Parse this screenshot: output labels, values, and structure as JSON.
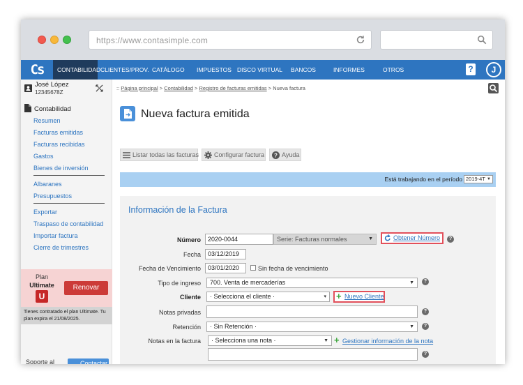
{
  "browser": {
    "url": "https://www.contasimple.com"
  },
  "nav": {
    "logo": "Cs",
    "items": [
      {
        "label": "CONTABILIDAD"
      },
      {
        "label": "CLIENTES/PROV."
      },
      {
        "label": "CATÁLOGO"
      },
      {
        "label": "IMPUESTOS"
      },
      {
        "label": "DISCO VIRTUAL"
      },
      {
        "label": "BANCOS"
      },
      {
        "label": "INFORMES"
      },
      {
        "label": "OTROS"
      }
    ],
    "help": "?",
    "avatar": "J"
  },
  "user": {
    "name": "José López",
    "id": "12345678Z"
  },
  "sidebar": {
    "heading": "Contabilidad",
    "group1": [
      {
        "label": "Resumen"
      },
      {
        "label": "Facturas emitidas"
      },
      {
        "label": "Facturas recibidas"
      },
      {
        "label": "Gastos"
      },
      {
        "label": "Bienes de inversión"
      }
    ],
    "group2": [
      {
        "label": "Albaranes"
      },
      {
        "label": "Presupuestos"
      }
    ],
    "group3": [
      {
        "label": "Exportar"
      },
      {
        "label": "Traspaso de contabilidad"
      },
      {
        "label": "Importar factura"
      },
      {
        "label": "Cierre de trimestres"
      }
    ],
    "plan": {
      "label": "Plan",
      "name": "Ultimate",
      "badge": "U",
      "renew": "Renovar",
      "note": "Tienes contratado el plan Ultimate. Tu plan expira el 21/08/2025."
    },
    "support": "Soporte al",
    "contact": "Contactar"
  },
  "breadcrumb": {
    "prefix": "::",
    "items": [
      "Página principal",
      "Contabilidad",
      "Registro de facturas emitidas"
    ],
    "current": "Nueva factura",
    "sep": ">"
  },
  "page": {
    "title": "Nueva factura emitida"
  },
  "toolbar": {
    "list": "Listar todas las facturas",
    "config": "Configurar factura",
    "help": "Ayuda"
  },
  "period": {
    "text": "Está trabajando en el período",
    "value": "2019-4T"
  },
  "form": {
    "section_title": "Información de la Factura",
    "numero_label": "Número",
    "numero_value": "2020-0044",
    "serie_value": "Serie: Facturas normales",
    "obtener_numero": "Obtener Número",
    "fecha_label": "Fecha",
    "fecha_value": "03/12/2019",
    "vencimiento_label": "Fecha de Vencimiento",
    "vencimiento_value": "03/01/2020",
    "sin_vencimiento": "Sin fecha de vencimiento",
    "tipo_label": "Tipo de ingreso",
    "tipo_value": "700. Venta de mercaderías",
    "cliente_label": "Cliente",
    "cliente_value": "· Selecciona el cliente ·",
    "nuevo_cliente": "Nuevo Cliente",
    "notas_privadas_label": "Notas privadas",
    "retencion_label": "Retención",
    "retencion_value": "· Sin Retención ·",
    "notas_factura_label": "Notas en la factura",
    "notas_factura_value": "· Selecciona una nota ·",
    "gestionar_nota": "Gestionar información de la nota"
  },
  "colors": {
    "nav_blue": "#2e75c0",
    "nav_active": "#1f3b5c",
    "period_bar": "#a9d0f2",
    "renew_red": "#cc3b38",
    "highlight_red": "#e2505b"
  }
}
